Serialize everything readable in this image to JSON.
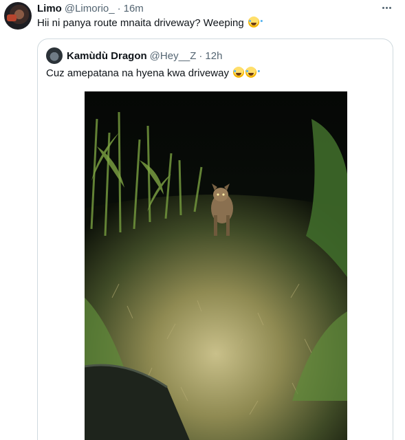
{
  "tweet": {
    "author_name": "Limo",
    "author_handle": "@Limorio_",
    "separator": "·",
    "time": "16m",
    "text": "Hii ni panya route mnaita driveway? Weeping",
    "emoji": "face-with-tears-of-joy"
  },
  "quoted": {
    "author_name": "Kamùdù Dragon",
    "author_handle": "@Hey__Z",
    "separator": "·",
    "time": "12h",
    "text": "Cuz amepatana na hyena kwa driveway",
    "emojis": [
      "face-with-tears-of-joy",
      "face-with-tears-of-joy"
    ],
    "media": {
      "type": "image",
      "subject": "hyena on a grassy path at night lit by headlights"
    }
  },
  "icons": {
    "more": "more-options-icon"
  },
  "colors": {
    "text": "#0f1419",
    "secondary": "#536471",
    "border": "#cfd9de"
  }
}
